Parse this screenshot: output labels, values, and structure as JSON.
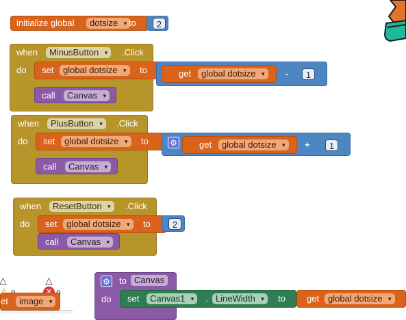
{
  "init": {
    "prefix": "initialize global",
    "var": "dotsize",
    "to": "to",
    "value": "2"
  },
  "minus": {
    "when": "when",
    "component": "MinusButton",
    "event": ".Click",
    "do": "do",
    "set": "set",
    "setvar": "global dotsize",
    "to": "to",
    "get": "get",
    "getvar": "global dotsize",
    "op": "-",
    "operand": "1",
    "call": "call",
    "callcomp": "Canvas"
  },
  "plus": {
    "when": "when",
    "component": "PlusButton",
    "event": ".Click",
    "do": "do",
    "set": "set",
    "setvar": "global dotsize",
    "to": "to",
    "get": "get",
    "getvar": "global dotsize",
    "op": "+",
    "operand": "1",
    "call": "call",
    "callcomp": "Canvas"
  },
  "reset": {
    "when": "when",
    "component": "ResetButton",
    "event": ".Click",
    "do": "do",
    "set": "set",
    "setvar": "global dotsize",
    "to": "to",
    "value": "2",
    "call": "call",
    "callcomp": "Canvas"
  },
  "proc": {
    "to": "to",
    "name": "Canvas",
    "do": "do",
    "set": "set",
    "component": "Canvas1",
    "dot": ".",
    "property": "LineWidth",
    "to2": "to",
    "get": "get",
    "getvar": "global dotsize"
  },
  "bottom": {
    "warn_count": "0",
    "error_count": "0",
    "block_prefix": "et",
    "block_label": "image"
  },
  "colors": {
    "variable": "#d9631a",
    "event": "#b8952b",
    "procedure": "#8a5aa6",
    "math": "#4e86c4",
    "component": "#2f7d52"
  }
}
